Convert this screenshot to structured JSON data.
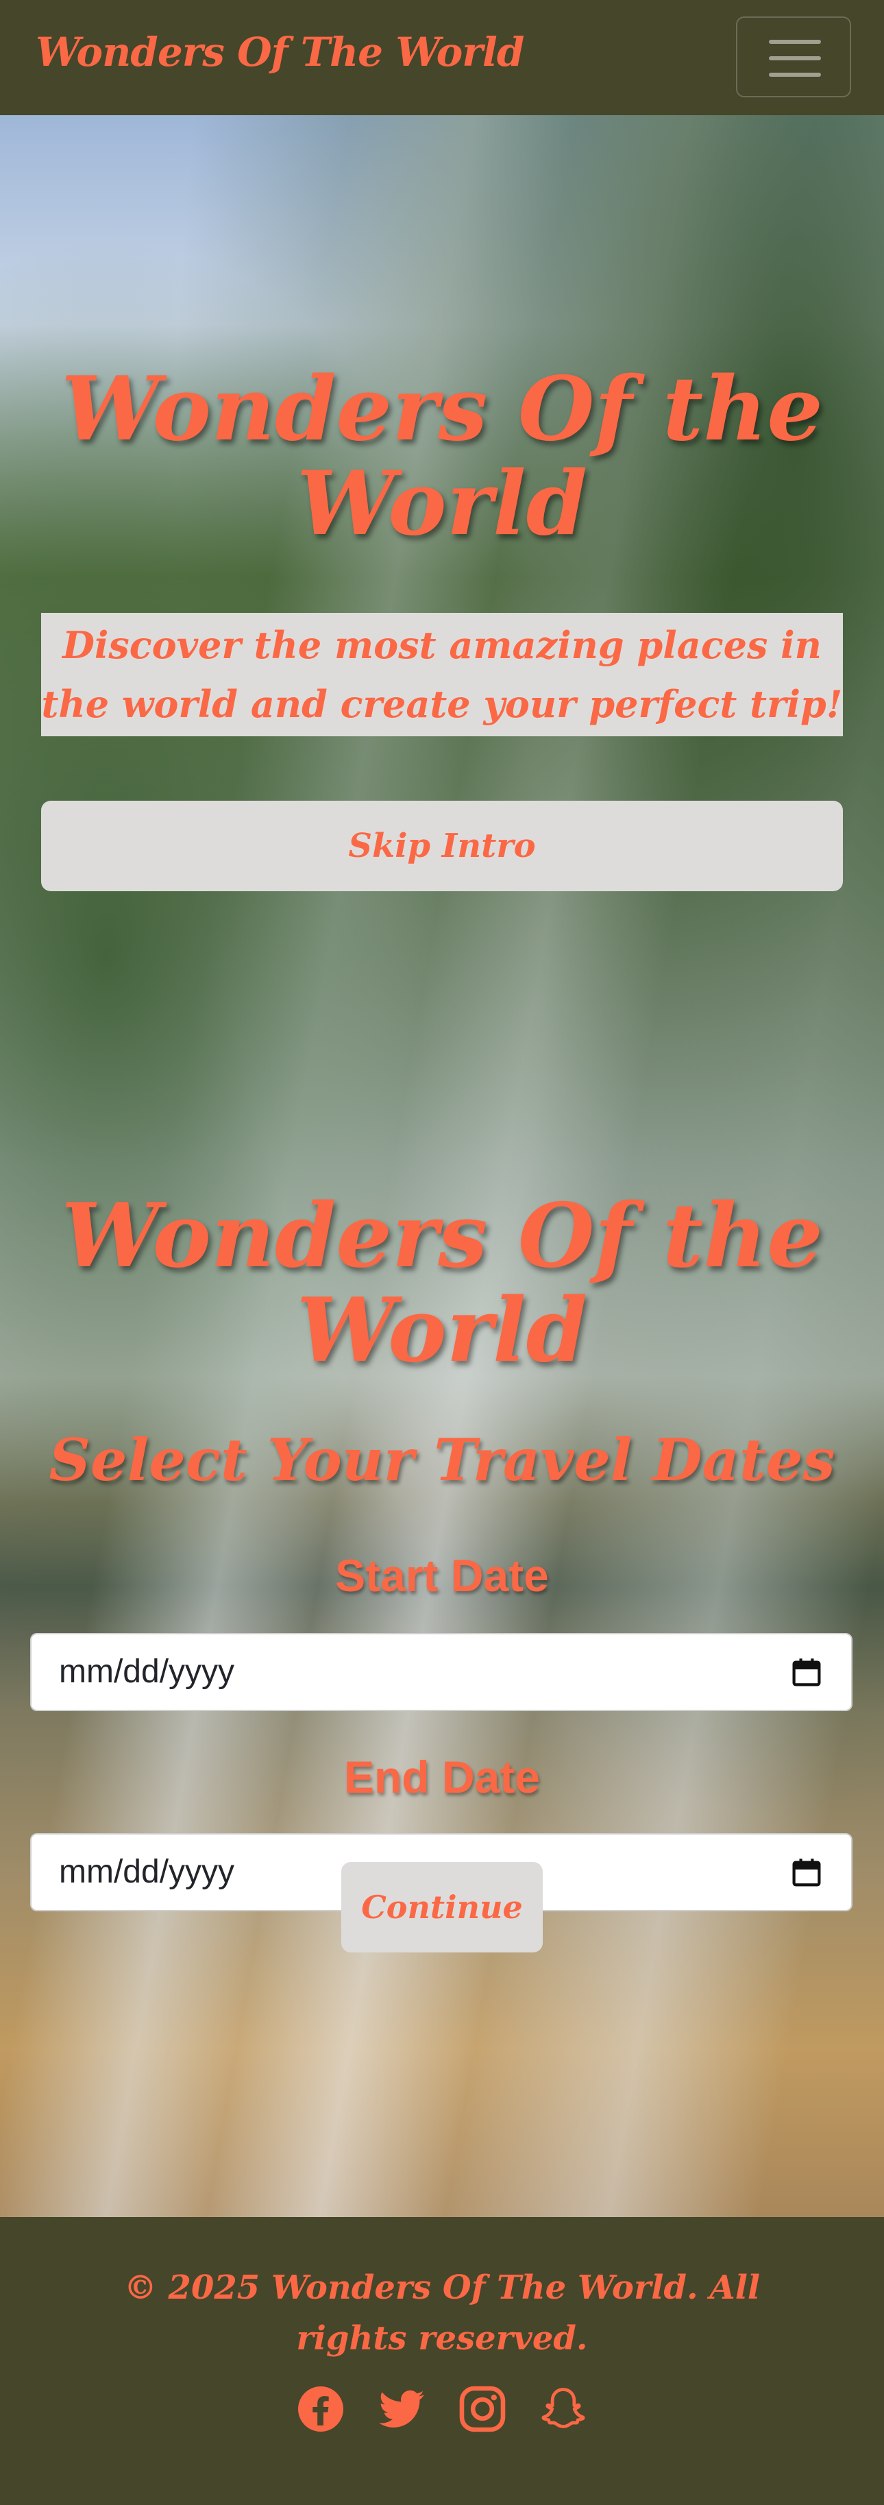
{
  "navbar": {
    "brand": "Wonders Of The World",
    "toggle_icon": "hamburger-menu-icon"
  },
  "intro": {
    "title": "Wonders Of the World",
    "tagline": "Discover the most amazing places in the world and create your perfect trip!",
    "skip_label": "Skip Intro"
  },
  "dates": {
    "title": "Wonders Of the World",
    "subtitle": "Select Your Travel Dates",
    "start_label": "Start Date",
    "start_placeholder": "mm/dd/yyyy",
    "end_label": "End Date",
    "end_placeholder": "mm/dd/yyyy",
    "continue_label": "Continue"
  },
  "footer": {
    "copyright": "© 2025 Wonders Of The World. All rights reserved.",
    "socials": [
      "facebook-icon",
      "twitter-icon",
      "instagram-icon",
      "snapchat-icon"
    ]
  },
  "colors": {
    "accent": "#fb6845",
    "navbar_bg": "#45462a",
    "panel_bg": "#dedcdb"
  }
}
